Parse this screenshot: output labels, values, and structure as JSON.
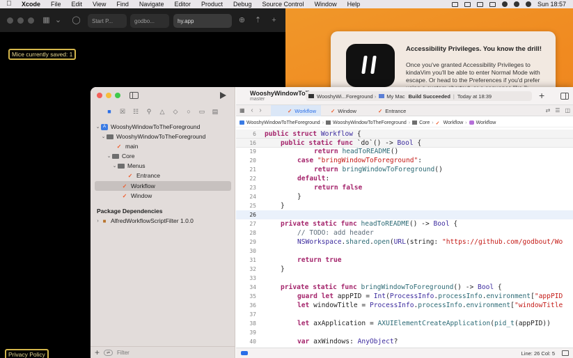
{
  "menubar": {
    "app": "Xcode",
    "items": [
      "File",
      "Edit",
      "View",
      "Find",
      "Navigate",
      "Editor",
      "Product",
      "Debug",
      "Source Control",
      "Window",
      "Help"
    ],
    "clock": "Sun 18:57"
  },
  "browser": {
    "tabs": [
      "Start P...",
      "godbo...",
      "hy.app"
    ],
    "mice_label": "Mice currently saved: 1",
    "privacy_label": "Privacy Policy"
  },
  "notice": {
    "title": "Accessibility  Privileges. You know the drill!",
    "body": "Once you've granted Accessibility Privileges to kindaVim you'll be able to enter Normal Mode with escape. Or head to the Preferences if you'd prefer using a custom shortcut, or a sequence like jk."
  },
  "xcode": {
    "project": "WooshyWindowToT...",
    "branch": "master",
    "scheme": "WooshyWi...Foreground",
    "destination": "My Mac",
    "build_status": "Build Succeeded",
    "build_time": "Today at 18:39",
    "tabs": [
      "Workflow",
      "Window",
      "Entrance"
    ],
    "breadcrumbs": [
      "WooshyWindowToTheForeground",
      "WooshyWindowToTheForeground",
      "Core",
      "Workflow",
      "Workflow"
    ],
    "navigator": {
      "rows": [
        {
          "label": "WooshyWindowToTheForeground",
          "icon": "project-icon"
        },
        {
          "label": "WooshyWindowToTheForeground",
          "icon": "folder-icon"
        },
        {
          "label": "main",
          "icon": "swift-file-icon"
        },
        {
          "label": "Core",
          "icon": "folder-icon"
        },
        {
          "label": "Menus",
          "icon": "folder-icon"
        },
        {
          "label": "Entrance",
          "icon": "swift-file-icon"
        },
        {
          "label": "Workflow",
          "icon": "swift-file-icon"
        },
        {
          "label": "Window",
          "icon": "swift-file-icon"
        }
      ],
      "package_header": "Package Dependencies",
      "package": "AlfredWorkflowScriptFilter 1.0.0",
      "filter_placeholder": "Filter"
    },
    "status_bar": "Line: 26  Col: 5"
  }
}
